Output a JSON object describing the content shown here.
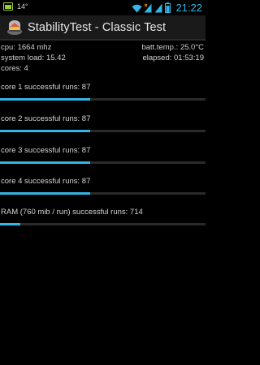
{
  "status_bar": {
    "temp": "14°",
    "time": "21:22",
    "icons": [
      "battery-icon",
      "wifi-icon",
      "signal-icon",
      "signal-icon",
      "battery-icon"
    ]
  },
  "app": {
    "title": "StabilityTest - Classic Test",
    "icon": "stability-app-icon"
  },
  "info": {
    "cpu": "cpu: 1664 mhz",
    "batt_temp": "batt.temp.: 25.0°C",
    "system_load": "system load: 15.42",
    "elapsed": "elapsed: 01:53:19",
    "cores": "cores: 4"
  },
  "runs": [
    {
      "label": "core 1 successful runs: 87",
      "progress": 0.44
    },
    {
      "label": "core 2 successful runs: 87",
      "progress": 0.44
    },
    {
      "label": "core 3 successful runs: 87",
      "progress": 0.44
    },
    {
      "label": "core 4 successful runs: 87",
      "progress": 0.44
    },
    {
      "label": "RAM (760 mib / run) successful runs: 714",
      "progress": 0.1
    }
  ],
  "colors": {
    "accent": "#33b5e5",
    "background": "#000000",
    "track": "#2a2a2a"
  }
}
